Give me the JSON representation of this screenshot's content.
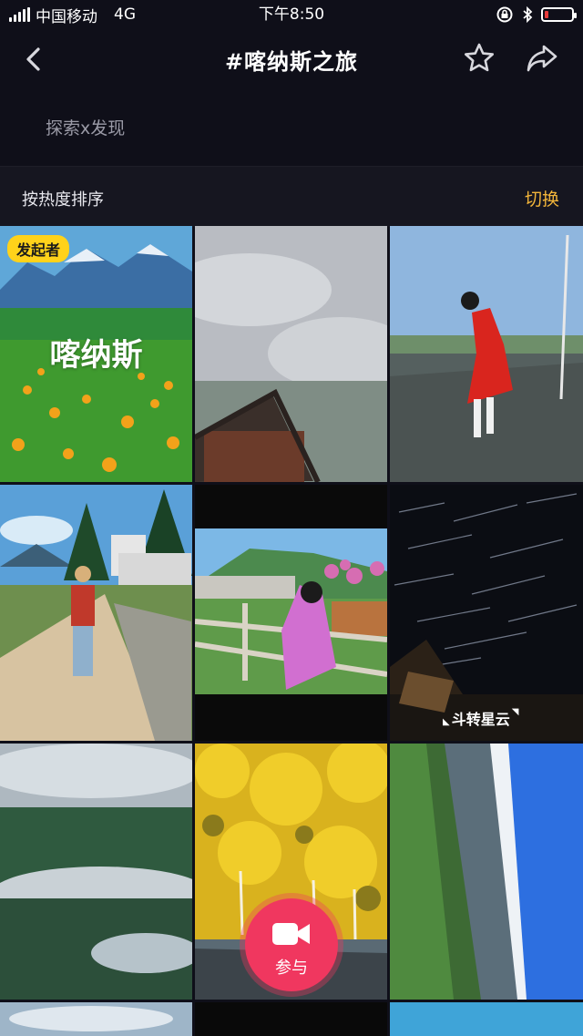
{
  "status_bar": {
    "carrier": "中国移动",
    "network": "4G",
    "time": "下午8:50",
    "battery_level": 0.15,
    "icons": [
      "signal-icon",
      "orientation-lock-icon",
      "bluetooth-icon",
      "battery-icon"
    ]
  },
  "header": {
    "title": "#喀纳斯之旅",
    "back_icon": "chevron-left-icon",
    "favorite_icon": "star-icon",
    "share_icon": "share-icon"
  },
  "subtitle": "探索x发现",
  "sort_bar": {
    "label": "按热度排序",
    "switch_label": "切换"
  },
  "grid": {
    "tiles": [
      {
        "scene": "meadow-mountains",
        "badge": "发起者",
        "overlay_text": "喀纳斯"
      },
      {
        "scene": "cabin-clouds"
      },
      {
        "scene": "red-dress-road"
      },
      {
        "scene": "boardwalk-village"
      },
      {
        "scene": "flowers-fence-girl"
      },
      {
        "scene": "star-trails-night",
        "caption": "斗转星云"
      },
      {
        "scene": "misty-forest"
      },
      {
        "scene": "golden-birch"
      },
      {
        "scene": "tilted-valley"
      }
    ]
  },
  "fab": {
    "label": "参与",
    "icon": "video-camera-icon",
    "color": "#f0375f"
  },
  "colors": {
    "background": "#0f0f19",
    "accent": "#f2b53a",
    "badge": "#ffd21a"
  }
}
